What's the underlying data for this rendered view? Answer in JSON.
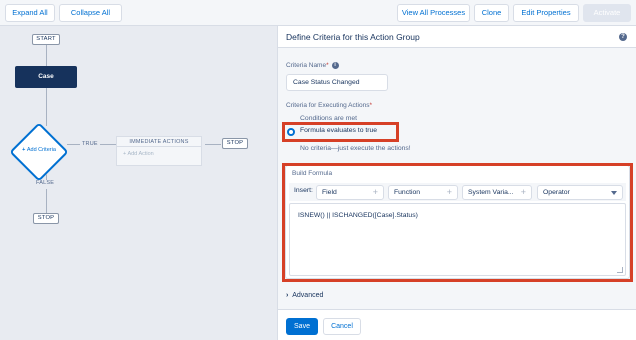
{
  "toolbar": {
    "expand_all": "Expand All",
    "collapse_all": "Collapse All",
    "view_all_processes": "View All Processes",
    "clone": "Clone",
    "edit_properties": "Edit Properties",
    "activate": "Activate"
  },
  "canvas": {
    "start": "START",
    "object_node": "Case",
    "criteria_node": "Add Criteria",
    "true_label": "TRUE",
    "false_label": "FALSE",
    "immediate_actions": "IMMEDIATE ACTIONS",
    "add_action": "Add Action",
    "stop_right": "STOP",
    "stop_bottom": "STOP"
  },
  "panel": {
    "title": "Define Criteria for this Action Group",
    "criteria_name_label": "Criteria Name",
    "criteria_name_value": "Case Status Changed",
    "executing_label": "Criteria for Executing Actions",
    "options": [
      {
        "label": "Conditions are met",
        "selected": false
      },
      {
        "label": "Formula evaluates to true",
        "selected": true
      },
      {
        "label": "No criteria—just execute the actions!",
        "selected": false
      }
    ],
    "build_formula": {
      "title": "Build Formula",
      "insert_label": "Insert:",
      "field": "Field",
      "function": "Function",
      "system_variables": "System Varia...",
      "operator": "Operator",
      "formula": "ISNEW() || ISCHANGED([Case].Status)"
    },
    "advanced": "Advanced",
    "save": "Save",
    "cancel": "Cancel"
  },
  "colors": {
    "accent": "#0070d2",
    "highlight": "#d64027",
    "navy": "#16325c"
  }
}
